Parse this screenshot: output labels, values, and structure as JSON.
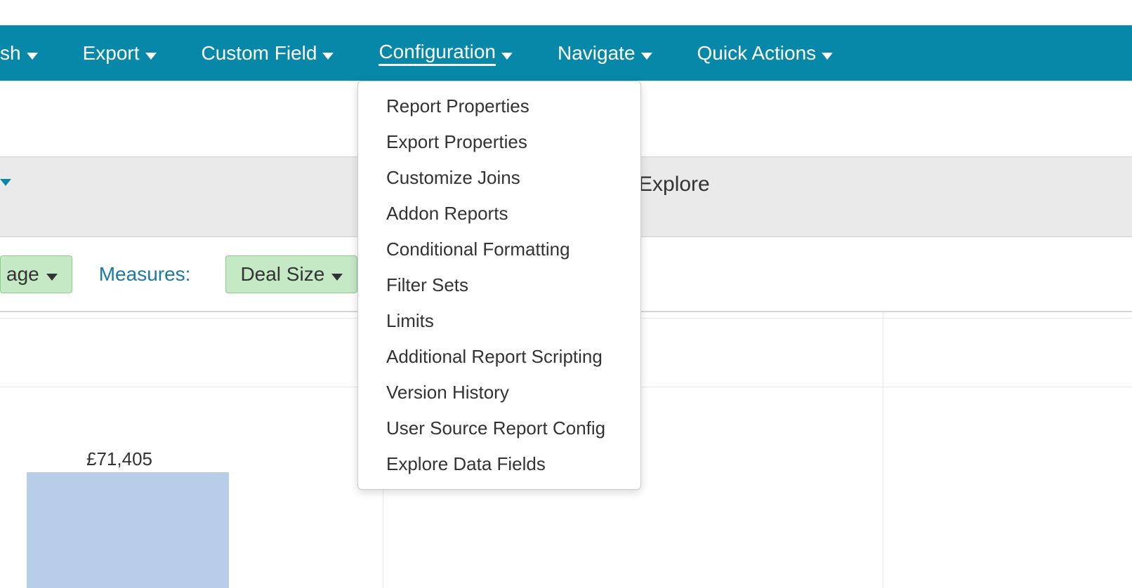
{
  "menubar": {
    "partial_item": "sh",
    "items": [
      {
        "label": "Export"
      },
      {
        "label": "Custom Field"
      },
      {
        "label": "Configuration"
      },
      {
        "label": "Navigate"
      },
      {
        "label": "Quick Actions"
      }
    ]
  },
  "dropdown": {
    "items": [
      "Report Properties",
      "Export Properties",
      "Customize Joins",
      "Addon Reports",
      "Conditional Formatting",
      "Filter Sets",
      "Limits",
      "Additional Report Scripting",
      "Version History",
      "User Source Report Config",
      "Explore Data Fields"
    ]
  },
  "toolbar": {
    "explore_label": "Explore",
    "measures_label": "Measures:",
    "pill_partial": "age",
    "pill_deal_size": "Deal Size"
  },
  "chart_data": {
    "type": "bar",
    "categories": [
      ""
    ],
    "values": [
      71405
    ],
    "labels": [
      "£71,405"
    ],
    "title": "",
    "xlabel": "",
    "ylabel": "",
    "ylim": [
      0,
      80000
    ]
  }
}
